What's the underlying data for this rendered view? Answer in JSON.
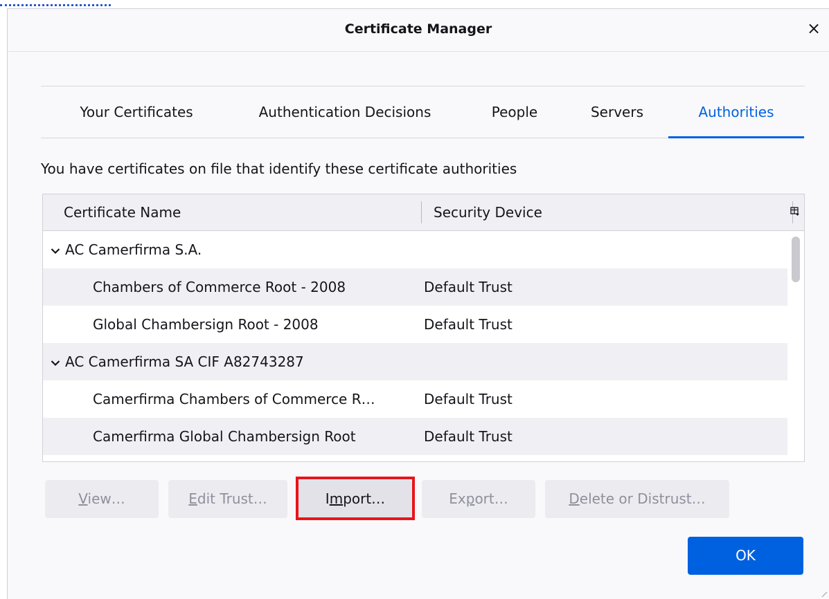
{
  "window": {
    "title": "Certificate Manager",
    "close_glyph": "×"
  },
  "tabs": [
    {
      "label": "Your Certificates",
      "selected": false
    },
    {
      "label": "Authentication Decisions",
      "selected": false
    },
    {
      "label": "People",
      "selected": false
    },
    {
      "label": "Servers",
      "selected": false
    },
    {
      "label": "Authorities",
      "selected": true
    }
  ],
  "description": "You have certificates on file that identify these certificate authorities",
  "table": {
    "columns": [
      "Certificate Name",
      "Security Device"
    ],
    "rows": [
      {
        "type": "group",
        "name": "AC Camerfirma S.A.",
        "device": ""
      },
      {
        "type": "item",
        "name": "Chambers of Commerce Root - 2008",
        "device": "Default Trust"
      },
      {
        "type": "item",
        "name": "Global Chambersign Root - 2008",
        "device": "Default Trust"
      },
      {
        "type": "group",
        "name": "AC Camerfirma SA CIF A82743287",
        "device": ""
      },
      {
        "type": "item",
        "name": "Camerfirma Chambers of Commerce R…",
        "device": "Default Trust"
      },
      {
        "type": "item",
        "name": "Camerfirma Global Chambersign Root",
        "device": "Default Trust"
      }
    ]
  },
  "buttons": {
    "view": {
      "accesskey": "V",
      "rest": "iew…",
      "enabled": false
    },
    "edit_trust": {
      "accesskey": "E",
      "rest": "dit Trust…",
      "enabled": false
    },
    "import": {
      "pre": "I",
      "accesskey": "m",
      "rest": "port…",
      "enabled": true
    },
    "export": {
      "pre": "Ex",
      "accesskey": "p",
      "rest": "ort…",
      "enabled": false
    },
    "delete": {
      "accesskey": "D",
      "rest": "elete or Distrust…",
      "enabled": false
    },
    "ok": "OK"
  },
  "colors": {
    "accent": "#0061e0",
    "highlight": "#e8141b"
  },
  "icons": {
    "close": "close-icon",
    "twisty": "chevron-down-icon",
    "column_picker": "column-picker-icon"
  }
}
